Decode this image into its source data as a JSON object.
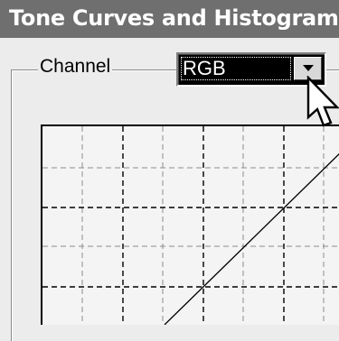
{
  "window": {
    "title": "Tone Curves and Histogram"
  },
  "channel": {
    "label": "Channel",
    "selected": "RGB"
  },
  "icons": {
    "dropdown": "chevron-down-icon",
    "pointer": "mouse-cursor-icon"
  },
  "colors": {
    "titlebar": "#6f6f6f",
    "combo_background": "#000000",
    "combo_text": "#ffffff",
    "grid_background": "#f4f4f4"
  }
}
